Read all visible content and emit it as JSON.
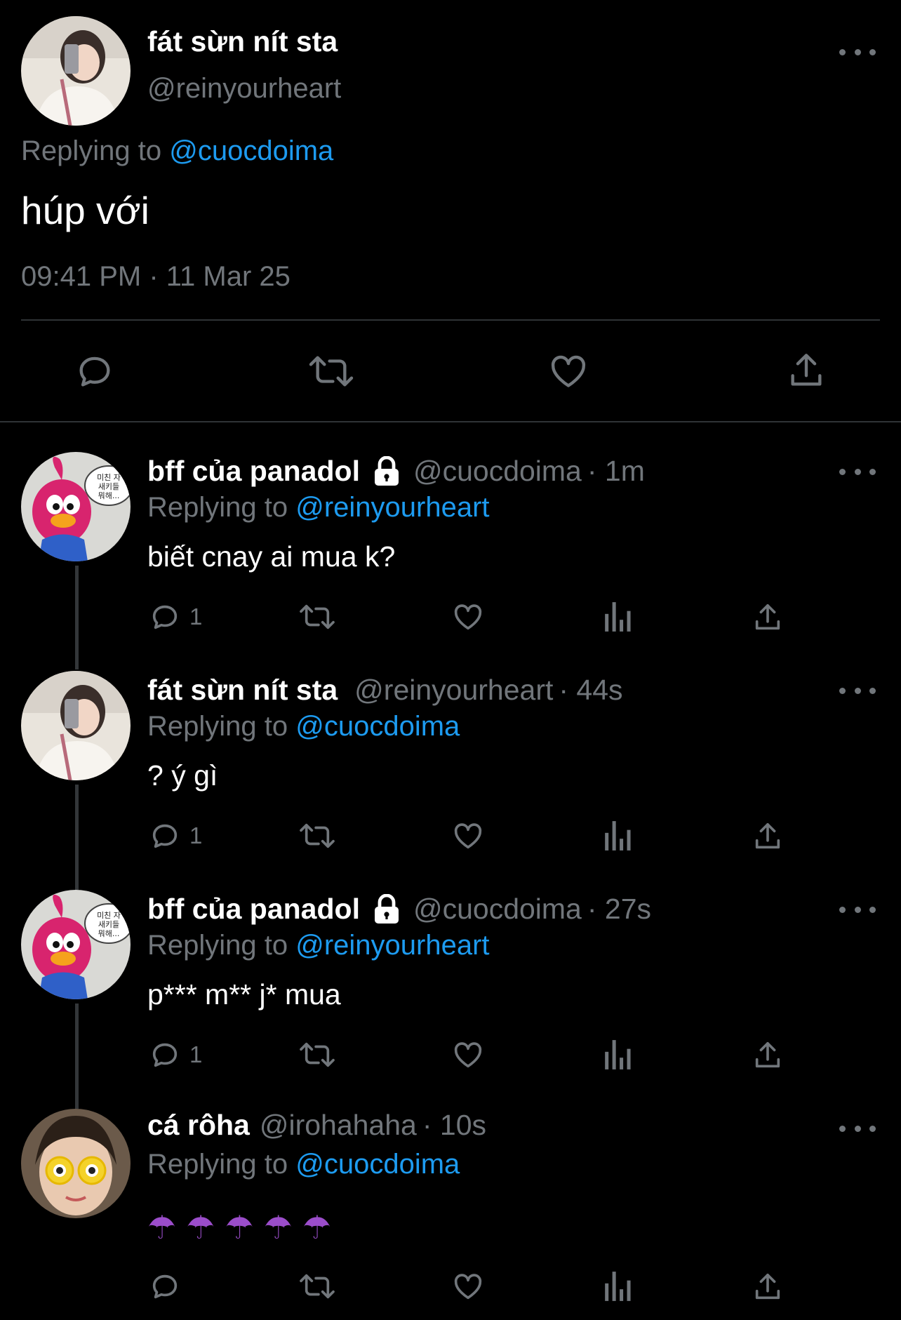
{
  "main_tweet": {
    "display_name": "fát sừn nít sta",
    "handle": "@reinyourheart",
    "replying_prefix": "Replying to",
    "replying_to": "@cuocdoima",
    "text": "húp với",
    "timestamp": "09:41 PM · 11 Mar 25"
  },
  "replies": [
    {
      "display_name": "bff của panadol",
      "handle": "@cuocdoima",
      "time": "· 1m",
      "replying_prefix": "Replying to",
      "replying_to": "@reinyourheart",
      "text": "biết cnay ai mua k?",
      "reply_count": "1",
      "avatar_text": "미친 자 새키들 뭐해..."
    },
    {
      "display_name": "fát sừn nít sta",
      "handle": "@reinyourheart",
      "time": "· 44s",
      "replying_prefix": "Replying to",
      "replying_to": "@cuocdoima",
      "text": "? ý gì",
      "reply_count": "1"
    },
    {
      "display_name": "bff của panadol",
      "handle": "@cuocdoima",
      "time": "· 27s",
      "replying_prefix": "Replying to",
      "replying_to": "@reinyourheart",
      "text": "p*** m** j* mua",
      "reply_count": "1",
      "avatar_text": "미친 자 새키들 뭐해..."
    },
    {
      "display_name": "cá rôha",
      "handle": "@irohahaha",
      "time": "· 10s",
      "replying_prefix": "Replying to",
      "replying_to": "@cuocdoima",
      "text": "☂☂☂☂☂",
      "reply_count": ""
    }
  ],
  "colors": {
    "background": "#000000",
    "text": "#e7e9ea",
    "secondary": "#71767b",
    "accent": "#1d9bf0",
    "divider": "#2f3336"
  },
  "icons": [
    "reply-icon",
    "retweet-icon",
    "like-icon",
    "views-icon",
    "share-icon",
    "lock-icon",
    "more-icon",
    "umbrella-icon"
  ]
}
